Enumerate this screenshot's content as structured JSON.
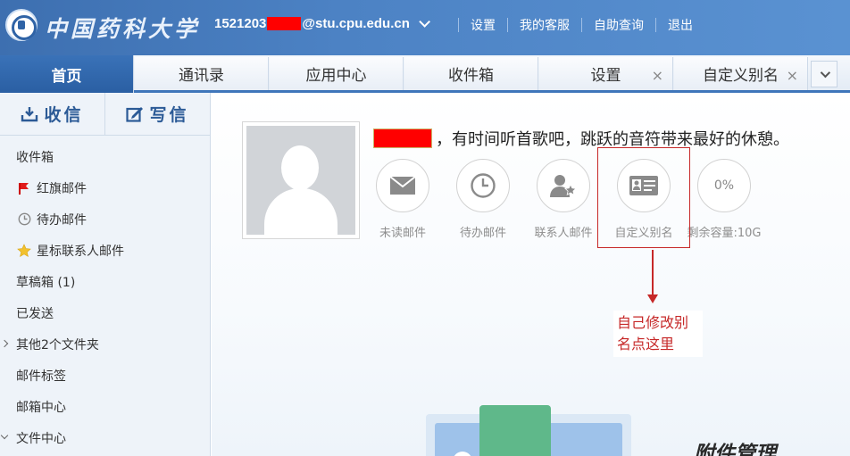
{
  "header": {
    "logo_text": "中国药科大学",
    "account_prefix": "1521203",
    "account_suffix": "@stu.cpu.edu.cn",
    "nav": [
      "设置",
      "我的客服",
      "自助查询",
      "退出"
    ]
  },
  "tabs": [
    {
      "label": "首页",
      "active": true,
      "closable": false
    },
    {
      "label": "通讯录",
      "active": false,
      "closable": false
    },
    {
      "label": "应用中心",
      "active": false,
      "closable": false
    },
    {
      "label": "收件箱",
      "active": false,
      "closable": false
    },
    {
      "label": "设置",
      "active": false,
      "closable": true
    },
    {
      "label": "自定义别名",
      "active": false,
      "closable": true
    }
  ],
  "tab_close_glyph": "×",
  "sidebar": {
    "receive_label": "收信",
    "compose_label": "写信",
    "folders": [
      {
        "label": "收件箱",
        "icon": null
      },
      {
        "label": "红旗邮件",
        "icon": "red-flag-icon"
      },
      {
        "label": "待办邮件",
        "icon": "clock-icon"
      },
      {
        "label": "星标联系人邮件",
        "icon": "star-icon"
      },
      {
        "label": "草稿箱 (1)",
        "icon": null
      },
      {
        "label": "已发送",
        "icon": null
      },
      {
        "label": "其他2个文件夹",
        "icon": "expand-right"
      },
      {
        "label": "邮件标签",
        "icon": null
      },
      {
        "label": "邮箱中心",
        "icon": null
      },
      {
        "label": "文件中心",
        "icon": "expand-down"
      }
    ]
  },
  "main": {
    "greeting": "，有时间听首歌吧，跳跃的音符带来最好的休憩。",
    "stats": [
      {
        "label": "未读邮件",
        "icon": "mail-icon"
      },
      {
        "label": "待办邮件",
        "icon": "clock-icon"
      },
      {
        "label": "联系人邮件",
        "icon": "contact-star-icon"
      },
      {
        "label": "自定义别名",
        "icon": "id-card-icon"
      },
      {
        "label": "剩余容量:10G",
        "icon": null,
        "value": "0%"
      }
    ],
    "annotation": "自己修改别名点这里",
    "attach_title": "附件管理"
  },
  "colors": {
    "header_blue": "#3d6fb0",
    "tab_active": "#2a5fa3",
    "annotation_red": "#c62828",
    "redaction_red": "#ff0000"
  }
}
